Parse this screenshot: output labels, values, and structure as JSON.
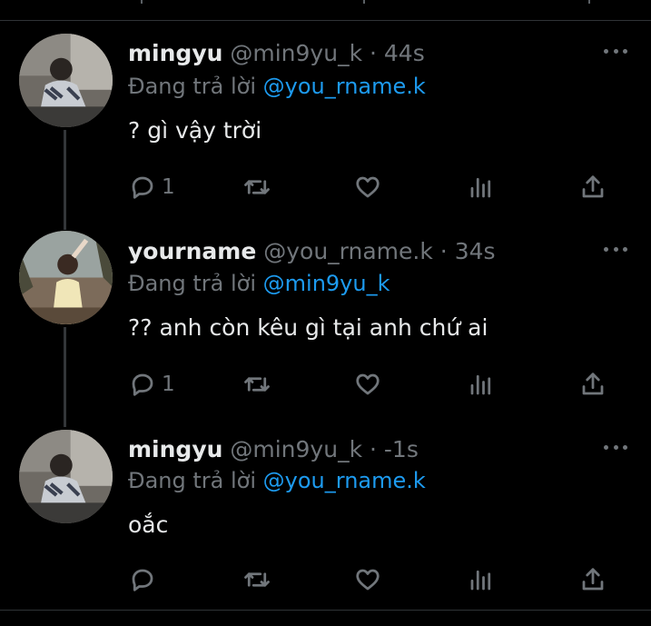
{
  "tweets": [
    {
      "name": "mingyu",
      "handle": "@min9yu_k",
      "dot": "·",
      "time": "44s",
      "reply_prefix": "Đang trả lời",
      "reply_to": "@you_rname.k",
      "text": "? gì vậy trời",
      "reply_count": "1",
      "avatar": "mingyu-avatar"
    },
    {
      "name": "yourname",
      "handle": "@you_rname.k",
      "dot": "·",
      "time": "34s",
      "reply_prefix": "Đang trả lời",
      "reply_to": "@min9yu_k",
      "text": "?? anh còn kêu gì tại anh chứ ai",
      "reply_count": "1",
      "avatar": "yourname-avatar"
    },
    {
      "name": "mingyu",
      "handle": "@min9yu_k",
      "dot": "·",
      "time": "-1s",
      "reply_prefix": "Đang trả lời",
      "reply_to": "@you_rname.k",
      "text": "oắc",
      "reply_count": "",
      "avatar": "mingyu-avatar"
    }
  ],
  "icons": [
    "reply-icon",
    "retweet-icon",
    "like-icon",
    "views-icon",
    "share-icon",
    "more-icon"
  ],
  "colors": {
    "background": "#000000",
    "text": "#e7e9ea",
    "muted": "#71767b",
    "mention": "#1d9bf0",
    "divider": "#2f3336"
  }
}
